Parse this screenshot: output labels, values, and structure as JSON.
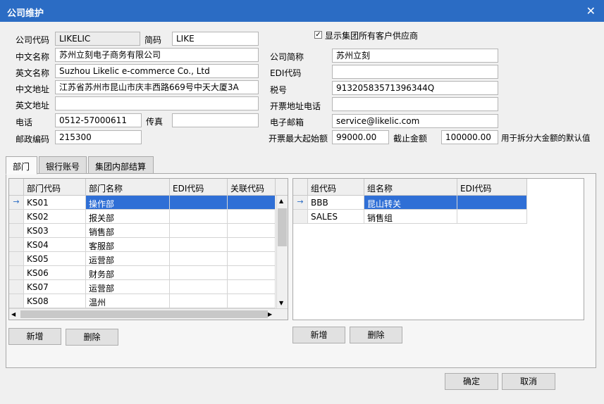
{
  "window": {
    "title": "公司维护",
    "close_glyph": "✕"
  },
  "form": {
    "company_code_label": "公司代码",
    "company_code": "LIKELIC",
    "short_code_label": "简码",
    "short_code": "LIKE",
    "show_all_label": "显示集团所有客户供应商",
    "show_all_checked": true,
    "cn_name_label": "中文名称",
    "cn_name": "苏州立刻电子商务有限公司",
    "en_name_label": "英文名称",
    "en_name": "Suzhou Likelic e-commerce Co., Ltd",
    "cn_addr_label": "中文地址",
    "cn_addr": "江苏省苏州市昆山市庆丰西路669号中天大厦3A",
    "en_addr_label": "英文地址",
    "en_addr": "",
    "phone_label": "电话",
    "phone": "0512-57000611",
    "fax_label": "传真",
    "fax": "",
    "zip_label": "邮政编码",
    "zip": "215300",
    "short_name_label": "公司简称",
    "short_name": "苏州立刻",
    "edi_label": "EDI代码",
    "edi": "",
    "tax_label": "税号",
    "tax": "91320583571396344Q",
    "invoice_addr_label": "开票地址电话",
    "invoice_addr": "",
    "email_label": "电子邮箱",
    "email": "service@likelic.com",
    "max_start_label": "开票最大起始额",
    "max_start": "99000.00",
    "cutoff_label": "截止金额",
    "cutoff": "100000.00",
    "split_note": "用于拆分大金额的默认值"
  },
  "tabs": [
    "部门",
    "银行账号",
    "集团内部结算"
  ],
  "dept_grid": {
    "columns": [
      "部门代码",
      "部门名称",
      "EDI代码",
      "关联代码"
    ],
    "rows": [
      [
        "KS01",
        "操作部",
        "",
        ""
      ],
      [
        "KS02",
        "报关部",
        "",
        ""
      ],
      [
        "KS03",
        "销售部",
        "",
        ""
      ],
      [
        "KS04",
        "客服部",
        "",
        ""
      ],
      [
        "KS05",
        "运营部",
        "",
        ""
      ],
      [
        "KS06",
        "财务部",
        "",
        ""
      ],
      [
        "KS07",
        "运营部",
        "",
        ""
      ],
      [
        "KS08",
        "温州",
        "",
        ""
      ]
    ],
    "current_indicator": "→"
  },
  "group_grid": {
    "columns": [
      "组代码",
      "组名称",
      "EDI代码"
    ],
    "rows": [
      [
        "BBB",
        "昆山转关",
        ""
      ],
      [
        "SALES",
        "销售组",
        ""
      ]
    ],
    "current_indicator": "→"
  },
  "buttons": {
    "add": "新增",
    "delete": "删除",
    "ok": "确定",
    "cancel": "取消"
  },
  "scroll_glyphs": {
    "up": "▲",
    "down": "▼",
    "left": "◀",
    "right": "▶"
  }
}
